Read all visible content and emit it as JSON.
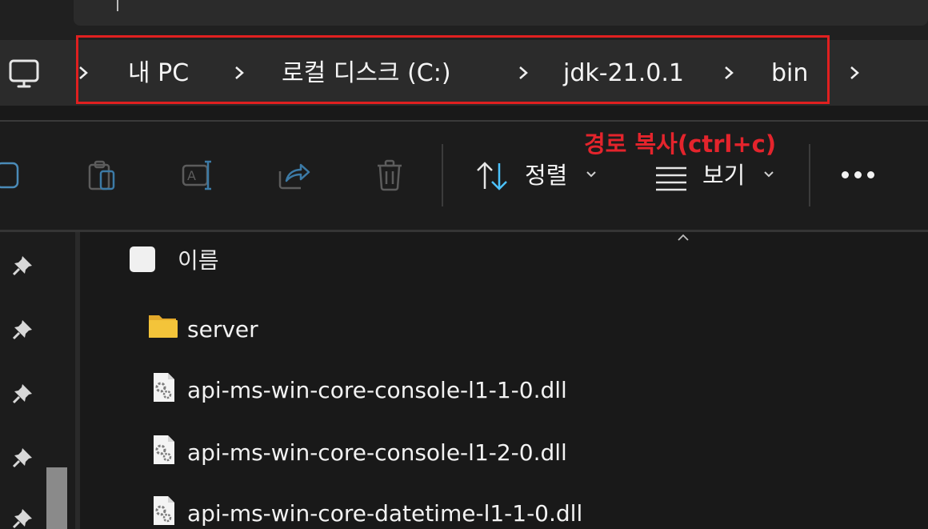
{
  "breadcrumb": {
    "items": [
      "내 PC",
      "로컬 디스크 (C:)",
      "jdk-21.0.1",
      "bin"
    ]
  },
  "toolbar": {
    "sort_label": "정렬",
    "view_label": "보기"
  },
  "annotation": {
    "text": "경로 복사(ctrl+c)",
    "color": "#e4242c"
  },
  "file_list": {
    "header_name": "이름",
    "items": [
      {
        "name": "server",
        "icon": "folder-icon"
      },
      {
        "name": "api-ms-win-core-console-l1-1-0.dll",
        "icon": "dll-file-icon"
      },
      {
        "name": "api-ms-win-core-console-l1-2-0.dll",
        "icon": "dll-file-icon"
      },
      {
        "name": "api-ms-win-core-datetime-l1-1-0.dll",
        "icon": "dll-file-icon"
      }
    ]
  },
  "colors": {
    "highlight_box": "#e02020",
    "accent_blue": "#4cc2ff",
    "folder_yellow": "#f3c43a"
  }
}
